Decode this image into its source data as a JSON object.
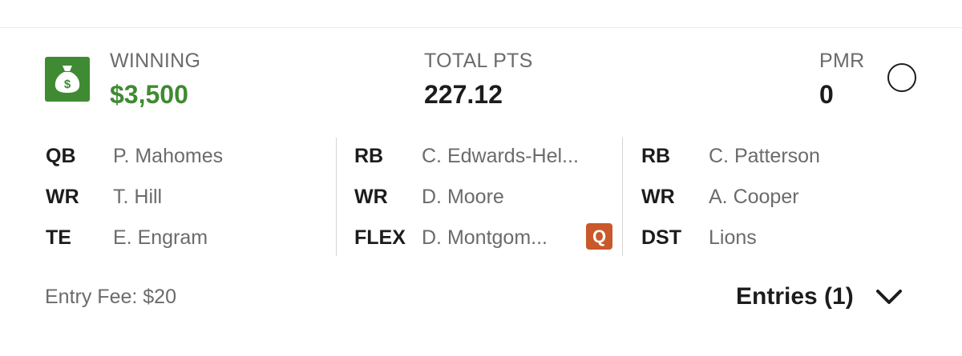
{
  "summary": {
    "winning_label": "WINNING",
    "winning_value": "$3,500",
    "total_pts_label": "TOTAL PTS",
    "total_pts_value": "227.12",
    "pmr_label": "PMR",
    "pmr_value": "0"
  },
  "lineup": {
    "columns": [
      [
        {
          "pos": "QB",
          "player": "P. Mahomes"
        },
        {
          "pos": "WR",
          "player": "T. Hill"
        },
        {
          "pos": "TE",
          "player": "E. Engram"
        }
      ],
      [
        {
          "pos": "RB",
          "player": "C. Edwards-Hel..."
        },
        {
          "pos": "WR",
          "player": "D. Moore"
        },
        {
          "pos": "FLEX",
          "player": "D. Montgom...",
          "status": "Q"
        }
      ],
      [
        {
          "pos": "RB",
          "player": "C. Patterson"
        },
        {
          "pos": "WR",
          "player": "A. Cooper"
        },
        {
          "pos": "DST",
          "player": "Lions"
        }
      ]
    ]
  },
  "footer": {
    "entry_fee": "Entry Fee: $20",
    "entries_label": "Entries (1)"
  },
  "icons": {
    "money": "money-bag-icon",
    "chevron": "chevron-down-icon"
  },
  "colors": {
    "accent_green": "#3f8a32",
    "status_orange": "#c9582a",
    "muted_text": "#6b6b6b",
    "primary_text": "#1c1c1c"
  }
}
